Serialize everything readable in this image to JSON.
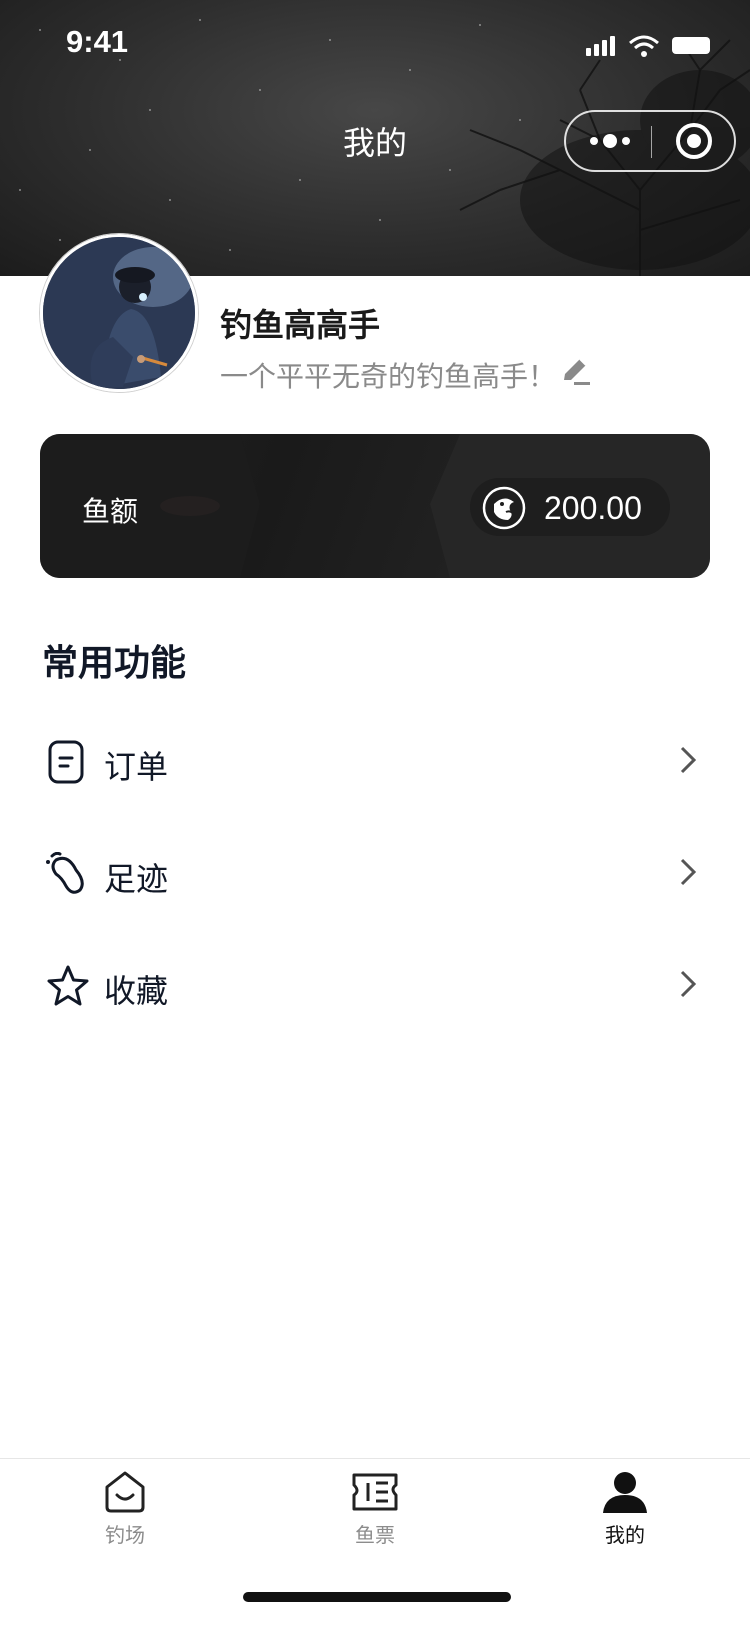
{
  "status_bar": {
    "time": "9:41"
  },
  "nav": {
    "title": "我的"
  },
  "profile": {
    "name": "钓鱼高高手",
    "bio": "一个平平无奇的钓鱼高手！"
  },
  "balance": {
    "label": "鱼额",
    "value": "200.00"
  },
  "section": {
    "title": "常用功能"
  },
  "menu": [
    {
      "label": "订单",
      "icon": "order-icon"
    },
    {
      "label": "足迹",
      "icon": "footprint-icon"
    },
    {
      "label": "收藏",
      "icon": "star-icon"
    }
  ],
  "tabbar": [
    {
      "label": "钓场",
      "icon": "home-icon",
      "active": false
    },
    {
      "label": "鱼票",
      "icon": "ticket-icon",
      "active": false
    },
    {
      "label": "我的",
      "icon": "user-icon",
      "active": true
    }
  ],
  "colors": {
    "primary_text": "#111827",
    "muted_text": "#8a8a8a",
    "card_bg": "#1a1a1a"
  }
}
